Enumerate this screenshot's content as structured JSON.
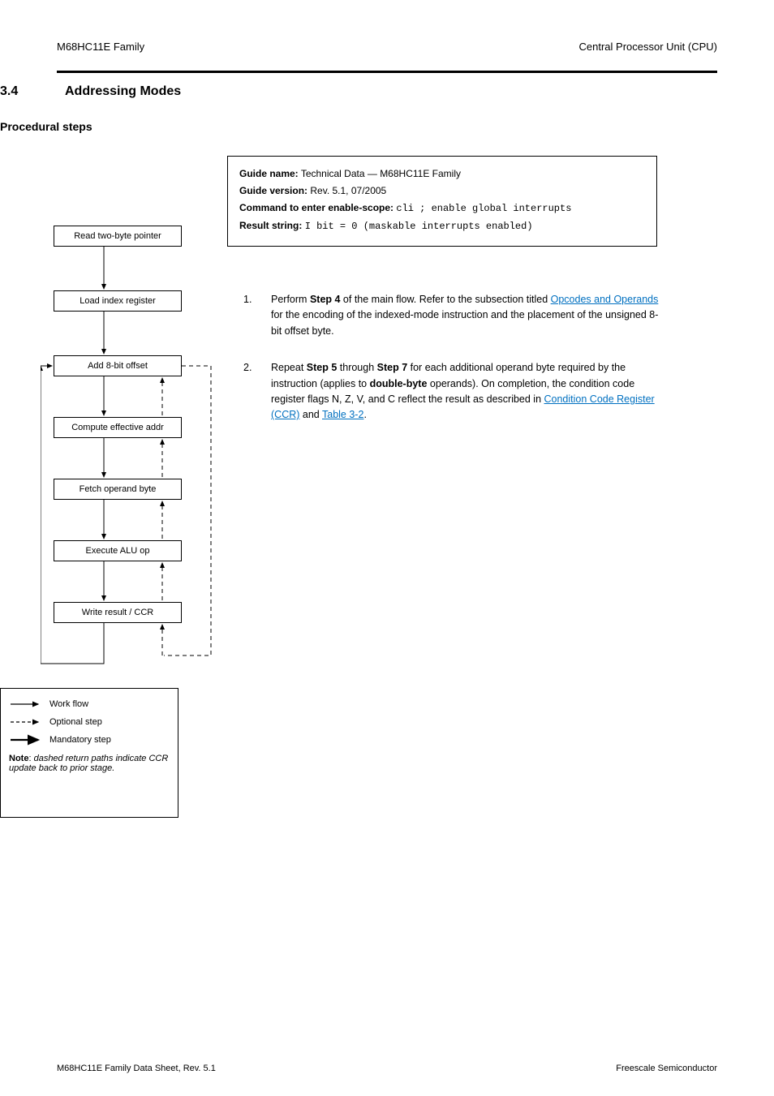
{
  "header": {
    "product": "M68HC11E Family",
    "section_path": "Central Processor Unit (CPU)"
  },
  "section": {
    "number": "3.4",
    "title": "Addressing Modes"
  },
  "procedure": {
    "title": "Procedural steps"
  },
  "info_box": {
    "line1_label": "Guide name:",
    "line1_value": "Technical Data — M68HC11E Family",
    "line2_label": "Guide version:",
    "line2_value": "Rev. 5.1, 07/2005",
    "line3_label": "Command to enter enable-scope:",
    "line3_value": "cli ; enable global interrupts",
    "line4_label": "Result string:",
    "line4_value": "I bit = 0 (maskable interrupts enabled)"
  },
  "flow": {
    "boxes": [
      "Read two-byte pointer",
      "Load index register",
      "Add 8-bit offset",
      "Compute effective addr",
      "Fetch operand byte",
      "Execute ALU op",
      "Write result / CCR"
    ]
  },
  "right": {
    "items": [
      {
        "num": "1.",
        "html": "Perform <b>Step 4</b> of the main flow. Refer to the subsection titled <span class='link'>Opcodes and Operands</span> for the encoding of the indexed-mode instruction and the placement of the unsigned 8-bit offset byte."
      },
      {
        "num": "2.",
        "html": "Repeat <b>Step 5</b> through <b>Step 7</b> for each additional operand byte required by the instruction (applies to <b>double-byte</b> operands). On completion, the condition code register flags N, Z, V, and C reflect the result as described in <span class='link'>Condition Code Register (CCR)</span> and <span class='link'>Table 3-2</span>."
      }
    ]
  },
  "legend": {
    "workflow": "Work flow",
    "optional": "Optional step",
    "mandatory": "Mandatory step",
    "note_label": "Note",
    "note_text": "dashed return paths indicate CCR update back to prior stage."
  },
  "footer": {
    "left": "M68HC11E Family Data Sheet, Rev. 5.1",
    "right": "Freescale Semiconductor"
  }
}
